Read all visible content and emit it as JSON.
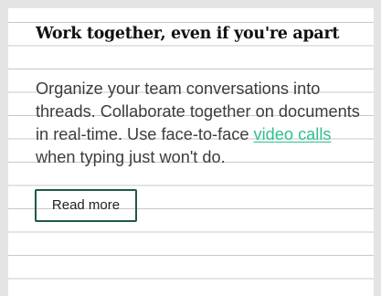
{
  "card": {
    "title": "Work together, even if you're apart",
    "body": {
      "text_before_link": "Organize your team conversations into threads. Collaborate together on documents in real-time. Use face-to-face ",
      "link_text": "video calls",
      "text_after_link": " when typing just won't do."
    },
    "read_more_label": "Read more"
  },
  "colors": {
    "link": "#2fbf8c",
    "button_border": "#1f5a46",
    "rule_lines": "#c8c8c8",
    "frame": "#e4e4e4"
  }
}
